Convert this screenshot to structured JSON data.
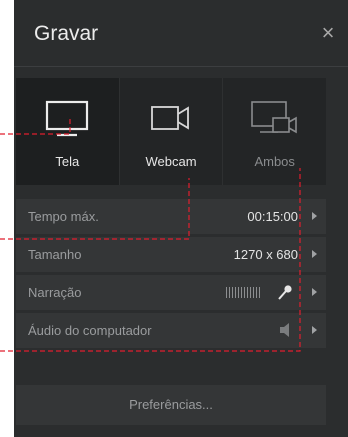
{
  "window": {
    "title": "Gravar",
    "close_icon": "close-icon"
  },
  "modes": [
    {
      "label": "Tela",
      "icon": "monitor-icon",
      "selected": true
    },
    {
      "label": "Webcam",
      "icon": "webcam-icon",
      "selected": false
    },
    {
      "label": "Ambos",
      "icon": "screen-and-webcam-icon",
      "selected": false
    }
  ],
  "settings": [
    {
      "label": "Tempo máx.",
      "value": "00:15:00"
    },
    {
      "label": "Tamanho",
      "value": "1270 x 680"
    },
    {
      "label": "Narração",
      "value": "",
      "icon": "microphone-icon"
    },
    {
      "label": "Áudio do computador",
      "value": "",
      "icon": "speaker-icon"
    }
  ],
  "footer": {
    "preferences_label": "Preferências..."
  },
  "colors": {
    "panel": "#2b2d2e",
    "callout": "#e01e2e",
    "text": "#e6e6e6"
  }
}
